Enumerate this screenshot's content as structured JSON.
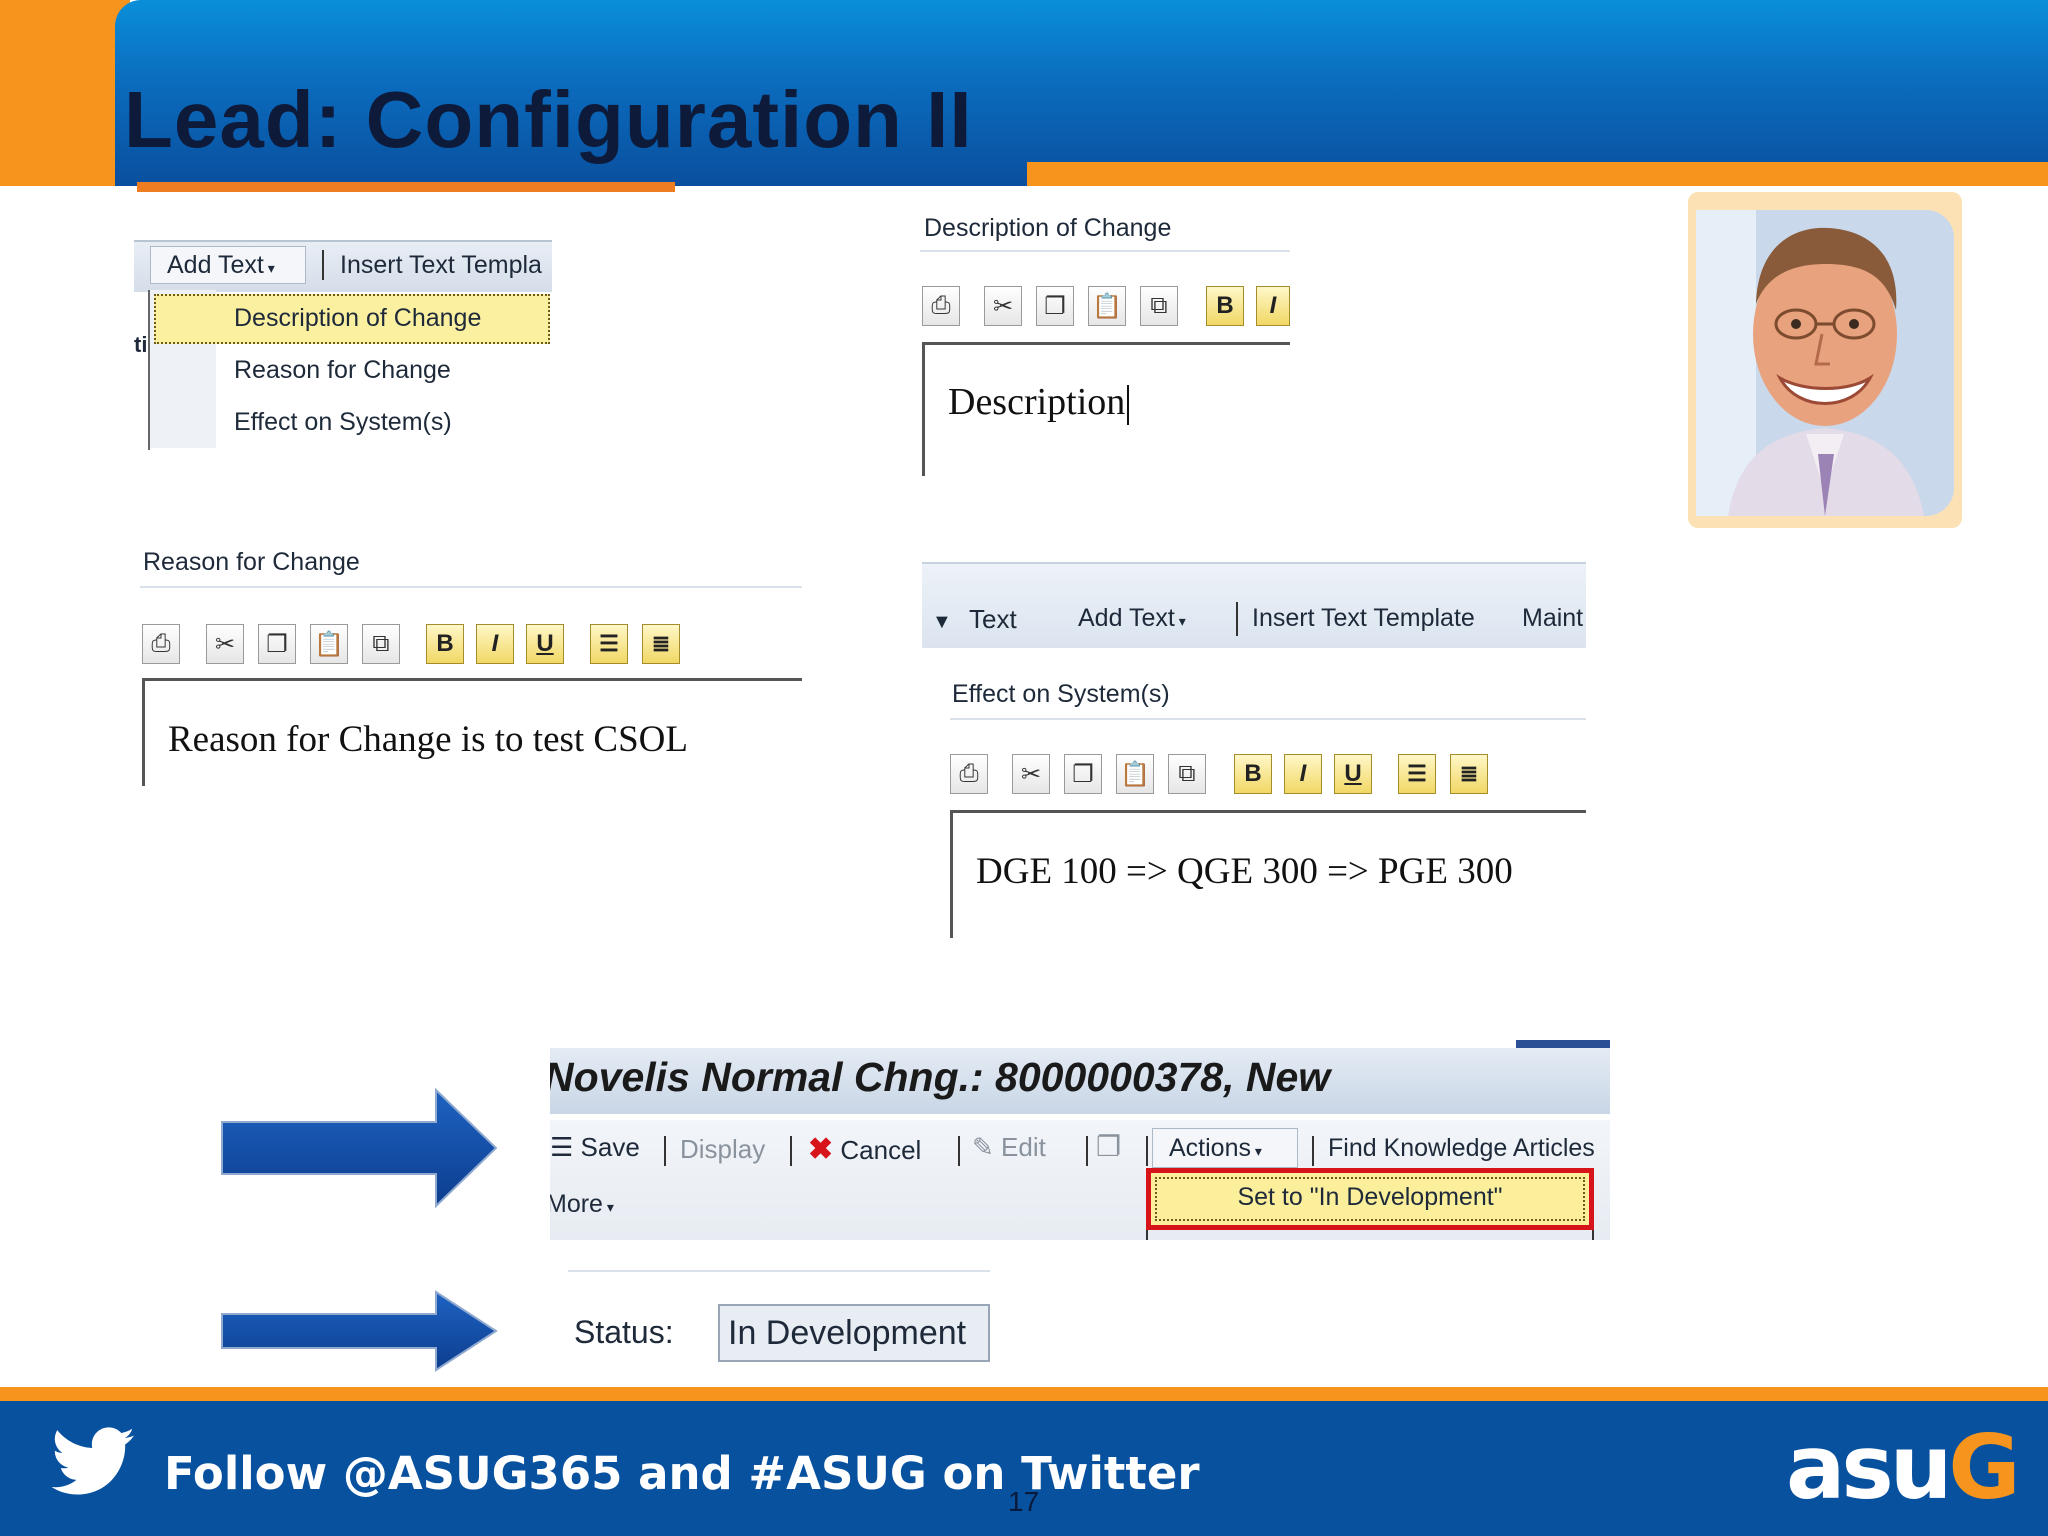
{
  "slide": {
    "title": "Lead: Configuration II",
    "page_number": "17"
  },
  "panel_add_text": {
    "add_text_button": "Add Text",
    "insert_text_template": "Insert Text Templa",
    "left_fragment": "ti",
    "menu_items": [
      "Description of Change",
      "Reason for Change",
      "Effect on System(s)"
    ]
  },
  "panel_description": {
    "heading": "Description of Change",
    "text": "Description"
  },
  "panel_reason": {
    "heading": "Reason for Change",
    "text": "Reason for Change is to test CSOL"
  },
  "panel_effect": {
    "tab_label": "Text",
    "add_text_button": "Add Text",
    "insert_text_template": "Insert Text Template",
    "maint_label": "Maint",
    "heading": "Effect on System(s)",
    "text": "DGE 100 => QGE 300 => PGE 300"
  },
  "change_doc": {
    "title": "Novelis Normal Chng.: 8000000378, New",
    "save": "Save",
    "display": "Display",
    "cancel": "Cancel",
    "edit": "Edit",
    "actions": "Actions",
    "find_articles": "Find Knowledge Articles",
    "more": "More",
    "action_item": "Set to \"In Development\""
  },
  "status": {
    "label": "Status:",
    "value": "In Development"
  },
  "footer": {
    "twitter_text": "Follow @ASUG365 and #ASUG on Twitter",
    "logo_text_main": "asu",
    "logo_text_accent": "G"
  },
  "colors": {
    "orange": "#f7941d",
    "header_blue": "#0b6bbd",
    "footer_blue": "#08519f",
    "highlight_yellow": "#fbefa0",
    "red_outline": "#d7141a"
  },
  "icons": {
    "toolbar": [
      "print-icon",
      "cut-icon",
      "copy-icon",
      "paste-icon",
      "paste-special-icon",
      "bold-icon",
      "italic-icon",
      "underline-icon",
      "align-left-icon",
      "justify-icon"
    ],
    "footer": "twitter-bird-icon"
  }
}
